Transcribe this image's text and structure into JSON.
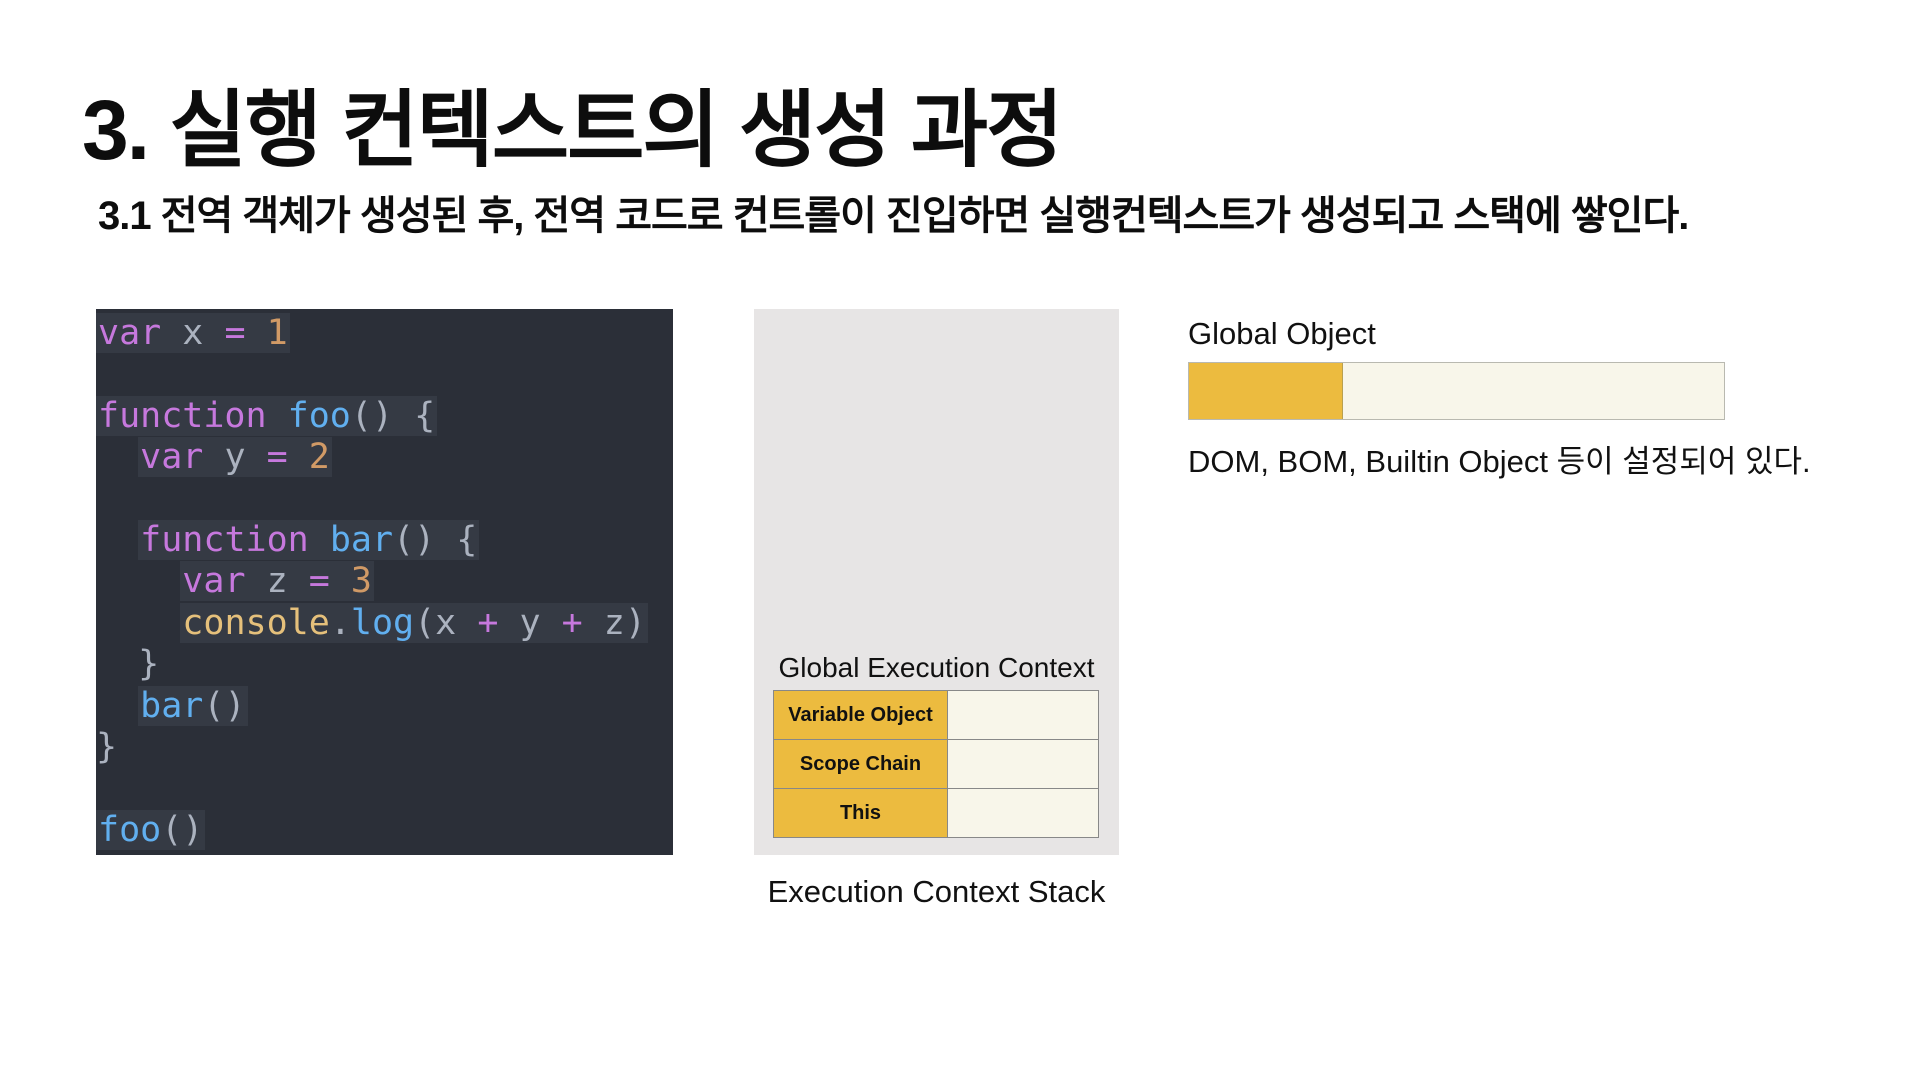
{
  "title": "3. 실행 컨텍스트의 생성 과정",
  "subtitle": "3.1 전역 객체가 생성된 후, 전역 코드로 컨트롤이 진입하면 실행컨텍스트가 생성되고 스택에 쌓인다.",
  "code": {
    "line1": {
      "kw": "var",
      "id": " x ",
      "op": "=",
      "num": " 1"
    },
    "line3": {
      "kw": "function",
      "fn": "foo",
      "rest": "() {"
    },
    "line4": {
      "indent": "  ",
      "kw": "var",
      "id": " y ",
      "op": "=",
      "num": " 2"
    },
    "line6": {
      "indent": "  ",
      "kw": "function",
      "fn": "bar",
      "rest": "() {"
    },
    "line7": {
      "indent": "    ",
      "kw": "var",
      "id": " z ",
      "op": "=",
      "num": " 3"
    },
    "line8": {
      "indent": "    ",
      "obj": "console",
      "dot": ".",
      "fn": "log",
      "p1": "(x ",
      "op1": "+",
      "p2": " y ",
      "op2": "+",
      "p3": " z)"
    },
    "line9": {
      "text": "  }"
    },
    "line10": {
      "indent": "  ",
      "fn": "bar",
      "rest": "()"
    },
    "line11": {
      "text": "}"
    },
    "line13": {
      "fn": "foo",
      "rest": "()"
    }
  },
  "stack": {
    "context_title": "Global Execution Context",
    "rows": [
      "Variable Object",
      "Scope Chain",
      "This"
    ],
    "caption": "Execution Context Stack"
  },
  "global_object": {
    "label": "Global Object",
    "description": "DOM, BOM, Builtin Object 등이 설정되어 있다."
  },
  "colors": {
    "accent_yellow": "#ecbb3f",
    "cell_cream": "#f8f6ea",
    "stack_bg": "#e7e5e5",
    "code_bg": "#2b2f38"
  }
}
